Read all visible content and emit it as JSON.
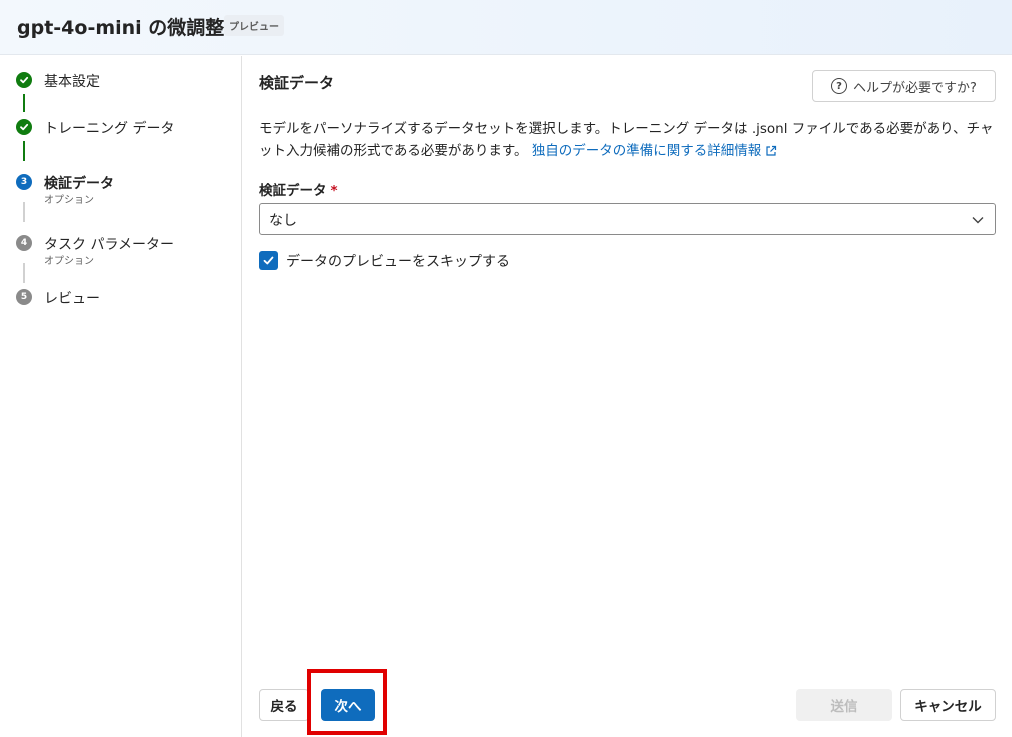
{
  "header": {
    "title": "gpt-4o-mini の微調整",
    "badge": "プレビュー"
  },
  "steps": [
    {
      "label": "基本設定",
      "sub": "",
      "status": "done",
      "number": "1"
    },
    {
      "label": "トレーニング データ",
      "sub": "",
      "status": "done",
      "number": "2"
    },
    {
      "label": "検証データ",
      "sub": "オプション",
      "status": "current",
      "number": "3"
    },
    {
      "label": "タスク パラメーター",
      "sub": "オプション",
      "status": "todo",
      "number": "4"
    },
    {
      "label": "レビュー",
      "sub": "",
      "status": "todo",
      "number": "5"
    }
  ],
  "main": {
    "title": "検証データ",
    "help_label": "ヘルプが必要ですか?",
    "description": "モデルをパーソナライズするデータセットを選択します。トレーニング データは .jsonl ファイルである必要があり、チャット入力候補の形式である必要があります。",
    "description_link": "独自のデータの準備に関する詳細情報",
    "field_label": "検証データ",
    "required_mark": "*",
    "select_value": "なし",
    "checkbox_label": "データのプレビューをスキップする",
    "checkbox_checked": true
  },
  "footer": {
    "back_label": "戻る",
    "next_label": "次へ",
    "submit_label": "送信",
    "cancel_label": "キャンセル"
  },
  "colors": {
    "accent": "#0f6cbd",
    "done": "#107c10",
    "highlight": "#e00000"
  }
}
